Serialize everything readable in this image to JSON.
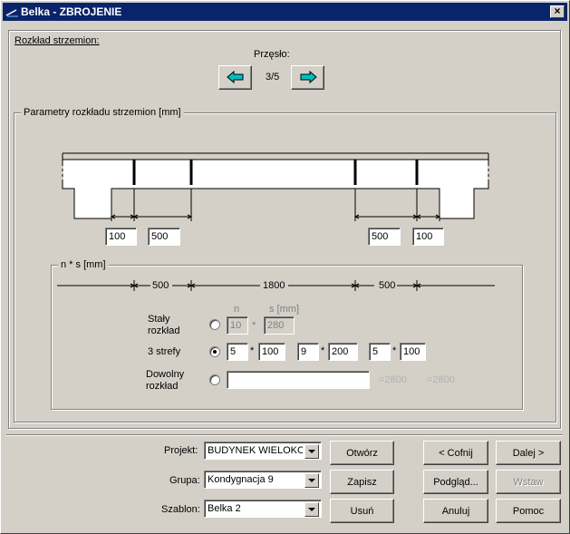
{
  "window": {
    "title": "Belka - ZBROJENIE",
    "close_glyph": "×"
  },
  "rozklad": {
    "label": "Rozkład strzemion:",
    "przeslo_label": "Przęsło:",
    "przeslo_value": "3/5"
  },
  "params": {
    "label": "Parametry rozkładu strzemion [mm]"
  },
  "beam_inputs": {
    "left_support": "100",
    "left_zone": "500",
    "right_zone": "500",
    "right_support": "100"
  },
  "ns": {
    "label": "n * s  [mm]",
    "dim_left": "500",
    "dim_mid": "1800",
    "dim_right": "500",
    "col_n": "n",
    "col_s": "s [mm]",
    "staly": {
      "label_line1": "Stały",
      "label_line2": "rozkład",
      "n": "10",
      "s": "280",
      "selected": false
    },
    "trzy": {
      "label": "3 strefy",
      "n1": "5",
      "s1": "100",
      "n2": "9",
      "s2": "200",
      "n3": "5",
      "s3": "100",
      "selected": true
    },
    "dowolny": {
      "label_line1": "Dowolny",
      "label_line2": "rozkład",
      "value": "",
      "selected": false,
      "sum1": "=2800",
      "sum2": "=2800"
    },
    "times": "*"
  },
  "bottom": {
    "projekt_label": "Projekt:",
    "projekt_value": "BUDYNEK WIELOKOND",
    "grupa_label": "Grupa:",
    "grupa_value": "Kondygnacja 9",
    "szablon_label": "Szablon:",
    "szablon_value": "Belka 2"
  },
  "buttons": {
    "otworz": "Otwórz",
    "zapisz": "Zapisz",
    "usun": "Usuń",
    "cofnij": "< Cofnij",
    "dalej": "Dalej >",
    "podglad": "Podgląd...",
    "wstaw": "Wstaw",
    "anuluj": "Anuluj",
    "pomoc": "Pomoc"
  },
  "colors": {
    "title_bar": "#0a246a",
    "arrow_fill": "#00c0c0"
  },
  "icons": {
    "prev": "arrow-left-icon",
    "next": "arrow-right-icon",
    "app": "beam-app-icon"
  }
}
